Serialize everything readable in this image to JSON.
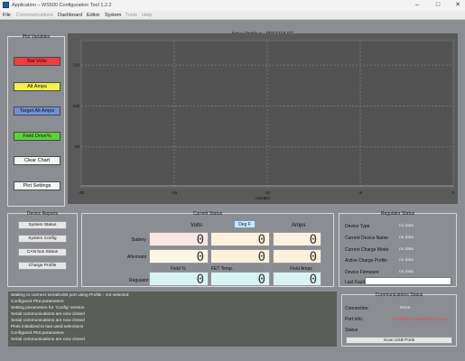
{
  "window": {
    "title": "Application –  WS500 Configuration Tool 1.2.2",
    "controls": [
      "–",
      "□",
      "✕"
    ]
  },
  "menu": [
    "File",
    "Communications",
    "Dashboard",
    "Editor",
    "System",
    "Tools",
    "Help"
  ],
  "plot_variables": {
    "title": "Plot Variables",
    "buttons": [
      {
        "label": "Bat Volts",
        "color": "#f23c3c"
      },
      {
        "label": "Alt Amps",
        "color": "#f3f04a"
      },
      {
        "label": "Target Alt Amps",
        "color": "#6f8fd8"
      },
      {
        "label": "Field Drive%",
        "color": "#5bd03a"
      }
    ],
    "clear_label": "Clear Chart",
    "settings_label": "Plot Settings"
  },
  "chart": {
    "title": "Active Profile is : PRESTOLITE",
    "xlabel": "minutes",
    "x_ticks": [
      "-20",
      "-15",
      "-10",
      "-5",
      "0"
    ],
    "y_ticks": [
      "150",
      "100",
      "50"
    ]
  },
  "chart_data": {
    "type": "line",
    "title": "Active Profile is : PRESTOLITE",
    "xlabel": "minutes",
    "ylabel": "",
    "xlim": [
      -20,
      0
    ],
    "ylim": [
      0,
      180
    ],
    "grid": true,
    "series": []
  },
  "device_reports": {
    "title": "Device Reports",
    "buttons": [
      "System Status",
      "System Config",
      "CAN bus Status",
      "Charge Profile"
    ]
  },
  "current_status": {
    "title": "Current Status",
    "deg_button": "Deg F",
    "col_volts": "Volts",
    "col_amps": "Amps",
    "row_battery": "Battery",
    "row_alternator": "Alternator",
    "row_regulator": "Regulator",
    "col_field": "Field %",
    "col_fet": "FET Temp.",
    "col_field_amps": "Field Amps",
    "battery_volts": "0",
    "battery_temp": "0",
    "battery_amps": "0",
    "alt_volts": "0",
    "alt_temp": "0",
    "alt_amps": "0",
    "field_pct": "0",
    "fet_temp": "0",
    "field_amps": "0"
  },
  "regulator_status": {
    "title": "Regulator Status",
    "rows": [
      {
        "label": "Device Type",
        "value": "no data"
      },
      {
        "label": "Current Device Name",
        "value": "no data"
      },
      {
        "label": "Current Charge Mode",
        "value": "no data"
      },
      {
        "label": "Active Charge Profile",
        "value": "no data"
      },
      {
        "label": "Device Firmware",
        "value": "no data"
      }
    ],
    "last_fault_label": "Last Fault",
    "last_fault_value": ""
  },
  "log": {
    "lines": [
      "Waiting to connect serial/USB port using Profile : not selected",
      "Configured Plot parameters",
      "Setting parameters for 'Config' version.",
      "Serial communications are now closed",
      "Serial communications are now closed",
      "Plots initialized to last used selections",
      "Configured Plot parameters",
      "Serial communications are now closed"
    ]
  },
  "comms": {
    "title": "Communications Status",
    "connection_label": "Connection:",
    "connection_value": "None",
    "port_label": "Port info:",
    "port_value": "No WS500 connections found",
    "port_color": "#ff3b3b",
    "status_label": "Status",
    "scan_label": "Scan USB Ports"
  }
}
